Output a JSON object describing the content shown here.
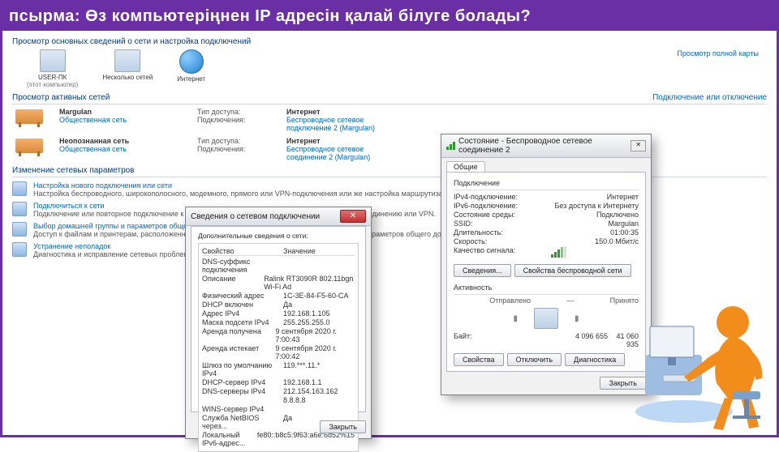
{
  "task_title": "псырма: Өз компьютеріңнен IP адресін қалай білуге болады?",
  "page_header": "Просмотр основных сведений о сети и настройка подключений",
  "map": {
    "view_full": "Просмотр полной карты",
    "this_pc": "USER-ПК",
    "this_pc_sub": "(этот компьютер)",
    "router": "Несколько сетей",
    "internet": "Интернет"
  },
  "sections": {
    "active_nets": "Просмотр активных сетей",
    "connect_or": "Подключение или отключение"
  },
  "net1": {
    "name": "Margulan",
    "type": "Общественная сеть",
    "access_label": "Тип доступа:",
    "access_value": "Интернет",
    "conn_label": "Подключения:",
    "conn_value": "Беспроводное сетевое\nподключение 2 (Margulan)"
  },
  "net2": {
    "name": "Неопознанная сеть",
    "type": "Общественная сеть",
    "access_label": "Тип доступа:",
    "access_value": "Интернет",
    "conn_label": "Подключения:",
    "conn_value": "Беспроводное сетевое\nсоединение 2 (Margulan)"
  },
  "options_title": "Изменение сетевых параметров",
  "opts": [
    {
      "link": "Настройка нового подключения или сети",
      "sub": "Настройка беспроводного, широкополосного, модемного, прямого или VPN-подключения или же настройка маршрутизатора или точки доступа."
    },
    {
      "link": "Подключиться к сети",
      "sub": "Подключение или повторное подключение к беспроводному, проводному, модемному сетевому соединению или VPN."
    },
    {
      "link": "Выбор домашней группы и параметров общего доступа",
      "sub": "Доступ к файлам и принтерам, расположенным на других сетевых компьютерах, или изменение параметров общего доступа."
    },
    {
      "link": "Устранение неполадок",
      "sub": "Диагностика и исправление сетевых проблем или получение сведений об устранении."
    }
  ],
  "details": {
    "title": "Сведения о сетевом подключении",
    "subtitle": "Дополнительные сведения о сети:",
    "cols": {
      "prop": "Свойство",
      "val": "Значение"
    },
    "rows": [
      [
        "DNS-суффикс подключения",
        ""
      ],
      [
        "Описание",
        "Ralink RT3090R 802.11bgn Wi-Fi Ad"
      ],
      [
        "Физический адрес",
        "1C-3E-84-F5-60-CA"
      ],
      [
        "DHCP включен",
        "Да"
      ],
      [
        "Адрес IPv4",
        "192.168.1.105"
      ],
      [
        "Маска подсети IPv4",
        "255.255.255.0"
      ],
      [
        "Аренда получена",
        "9 сентября 2020 г. 7:00:43"
      ],
      [
        "Аренда истекает",
        "9 сентября 2020 г. 7:00:42"
      ],
      [
        "Шлюз по умолчанию IPv4",
        "119.***.11.*"
      ],
      [
        "DHCP-сервер IPv4",
        "192.168.1.1"
      ],
      [
        "DNS-серверы IPv4",
        "212.154.163.162"
      ],
      [
        "",
        "8.8.8.8"
      ],
      [
        "WINS-сервер IPv4",
        ""
      ],
      [
        "Служба NetBIOS через...",
        "Да"
      ],
      [
        "Локальный IPv6-адрес...",
        "fe80::b8c5:9f63:a6e:6d52%15"
      ]
    ],
    "close": "Закрыть"
  },
  "status": {
    "title": "Состояние - Беспроводное сетевое соединение 2",
    "tab": "Общие",
    "group1": "Подключение",
    "rows1": [
      [
        "IPv4-подключение:",
        "Интернет"
      ],
      [
        "IPv6-подключение:",
        "Без доступа к Интернету"
      ],
      [
        "Состояние среды:",
        "Подключено"
      ],
      [
        "SSID:",
        "Margulan"
      ],
      [
        "Длительность:",
        "01:00:35"
      ],
      [
        "Скорость:",
        "150.0 Мбит/с"
      ]
    ],
    "signal_label": "Качество сигнала:",
    "btns1": [
      "Сведения...",
      "Свойства беспроводной сети"
    ],
    "group2": "Активность",
    "sent_label": "Отправлено",
    "recv_label": "Принято",
    "bytes_label": "Байт:",
    "sent": "4 096 655",
    "recv": "41 060 935",
    "btns2": [
      "Свойства",
      "Отключить",
      "Диагностика"
    ],
    "close": "Закрыть"
  }
}
